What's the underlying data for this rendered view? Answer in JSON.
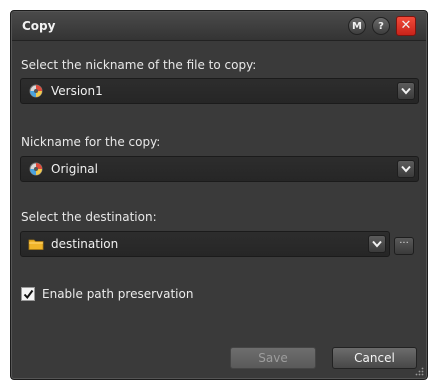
{
  "dialog": {
    "title": "Copy",
    "help_button": "?",
    "m_button": "M",
    "close_button": "✕"
  },
  "source": {
    "label": "Select the nickname of the file to copy:",
    "value": "Version1",
    "icon": "version-icon"
  },
  "nickname": {
    "label": "Nickname for the copy:",
    "value": "Original",
    "icon": "version-icon"
  },
  "destination": {
    "label": "Select the destination:",
    "value": "destination",
    "icon": "folder-icon",
    "browse_label": "···"
  },
  "path_preservation": {
    "label": "Enable path preservation",
    "checked": true
  },
  "buttons": {
    "save": "Save",
    "cancel": "Cancel"
  },
  "colors": {
    "dialog_bg": "#3a3a3a",
    "field_bg": "#2a2a2a",
    "close_red": "#e3372a",
    "folder_yellow": "#f0b429"
  }
}
